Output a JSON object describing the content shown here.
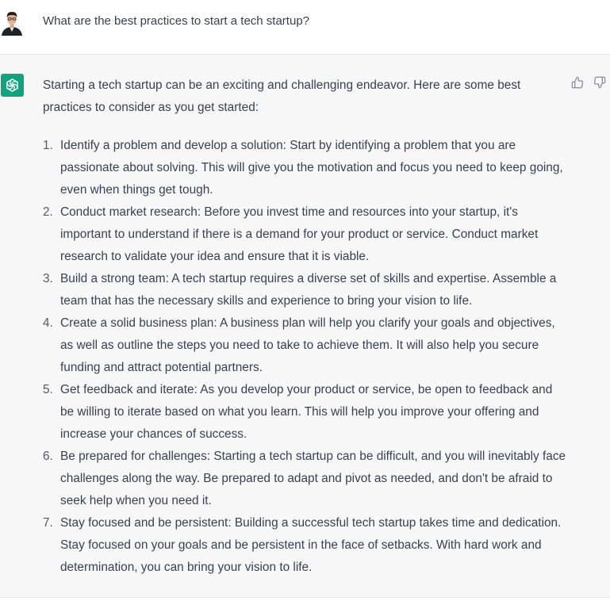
{
  "user_message": {
    "text": "What are the best practices to start a tech startup?",
    "avatar_icon": "user-avatar"
  },
  "assistant_message": {
    "avatar_icon": "openai-logo-icon",
    "avatar_color": "#10a37f",
    "intro": "Starting a tech startup can be an exciting and challenging endeavor. Here are some best practices to consider as you get started:",
    "points": [
      {
        "num": "1.",
        "text": "Identify a problem and develop a solution: Start by identifying a problem that you are passionate about solving. This will give you the motivation and focus you need to keep going, even when things get tough."
      },
      {
        "num": "2.",
        "text": "Conduct market research: Before you invest time and resources into your startup, it's important to understand if there is a demand for your product or service. Conduct market research to validate your idea and ensure that it is viable."
      },
      {
        "num": "3.",
        "text": "Build a strong team: A tech startup requires a diverse set of skills and expertise. Assemble a team that has the necessary skills and experience to bring your vision to life."
      },
      {
        "num": "4.",
        "text": "Create a solid business plan: A business plan will help you clarify your goals and objectives, as well as outline the steps you need to take to achieve them. It will also help you secure funding and attract potential partners."
      },
      {
        "num": "5.",
        "text": "Get feedback and iterate: As you develop your product or service, be open to feedback and be willing to iterate based on what you learn. This will help you improve your offering and increase your chances of success."
      },
      {
        "num": "6.",
        "text": "Be prepared for challenges: Starting a tech startup can be difficult, and you will inevitably face challenges along the way. Be prepared to adapt and pivot as needed, and don't be afraid to seek help when you need it."
      },
      {
        "num": "7.",
        "text": "Stay focused and be persistent: Building a successful tech startup takes time and dedication. Stay focused on your goals and be persistent in the face of setbacks. With hard work and determination, you can bring your vision to life."
      }
    ],
    "feedback_icons": [
      "thumbs-up-icon",
      "thumbs-down-icon"
    ]
  }
}
